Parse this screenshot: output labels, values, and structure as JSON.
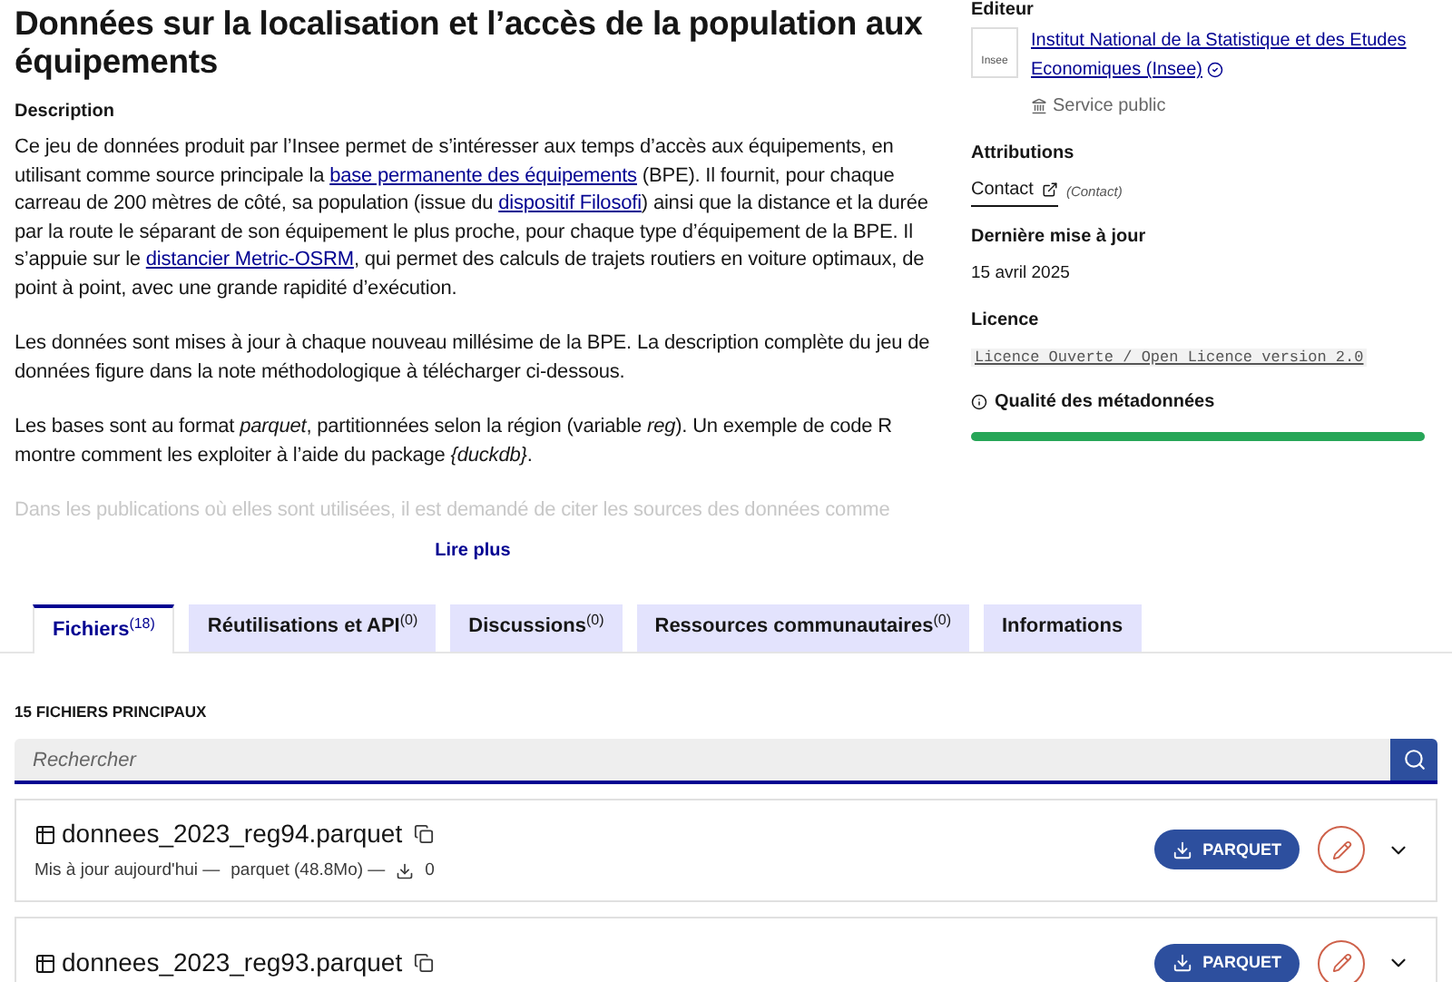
{
  "title": "Données sur la localisation et l’accès de la population aux équipements",
  "description": {
    "label": "Description",
    "paragraphs": [
      [
        {
          "kind": "text",
          "text": "Ce jeu de données produit par l’Insee permet de s’intéresser aux temps d’accès aux équipements, en utilisant comme source principale la "
        },
        {
          "kind": "link",
          "text": "base permanente des équipements"
        },
        {
          "kind": "text",
          "text": " (BPE). Il fournit, pour chaque carreau de 200 mètres de côté, sa population (issue du "
        },
        {
          "kind": "link",
          "text": "dispositif Filosofi"
        },
        {
          "kind": "text",
          "text": ") ainsi que la distance et la durée par la route le séparant de son équipement le plus proche, pour chaque type d’équipement de la BPE. Il s’appuie sur le "
        },
        {
          "kind": "link",
          "text": "distancier Metric-OSRM"
        },
        {
          "kind": "text",
          "text": ", qui permet des calculs de trajets routiers en voiture optimaux, de point à point, avec une grande rapidité d’exécution."
        }
      ],
      [
        {
          "kind": "text",
          "text": "Les données sont mises à jour à chaque nouveau millésime de la BPE. La description complète du jeu de données figure dans la note méthodologique à télécharger ci-dessous."
        }
      ],
      [
        {
          "kind": "text",
          "text": "Les bases sont au format *parquet*, partitionnées selon la région (variable *reg*). Un exemple de code R montre comment les exploiter à l’aide du package *{duckdb}*."
        }
      ]
    ],
    "faded": "Dans les publications où elles sont utilisées, il est demandé de citer les sources des données comme",
    "more": "Lire plus"
  },
  "sidebar": {
    "editor_label": "Editeur",
    "logo_text": "Insee",
    "editor_name": "Institut National de la Statistique et des Etudes Economiques (Insee)",
    "verified": true,
    "editor_type": "Service public",
    "attributions_label": "Attributions",
    "contact_link": "Contact",
    "contact_note": "(Contact)",
    "updated_label": "Dernière mise à jour",
    "updated": "15 avril 2025",
    "licence_label": "Licence",
    "licence": "Licence Ouverte / Open Licence version 2.0",
    "quality_label": "Qualité des métadonnées",
    "quality": {
      "level": 1.0
    }
  },
  "tabs": [
    {
      "label": "Fichiers",
      "count": "(18)",
      "selected": true
    },
    {
      "label": "Réutilisations et API",
      "count": "(0)",
      "selected": false
    },
    {
      "label": "Discussions",
      "count": "(0)",
      "selected": false
    },
    {
      "label": "Ressources communautaires",
      "count": "(0)",
      "selected": false
    },
    {
      "label": "Informations",
      "selected": false
    }
  ],
  "files": {
    "heading": "15 FICHIERS PRINCIPAUX",
    "search": {
      "placeholder": "Rechercher"
    },
    "rows": [
      {
        "name": "donnees_2023_reg94.parquet",
        "updated": "Mis à jour aujourd'hui —",
        "format": "parquet (48.8Mo) —",
        "downloads": "0",
        "button": "PARQUET"
      },
      {
        "name": "donnees_2023_reg93.parquet",
        "button": "PARQUET"
      }
    ]
  }
}
